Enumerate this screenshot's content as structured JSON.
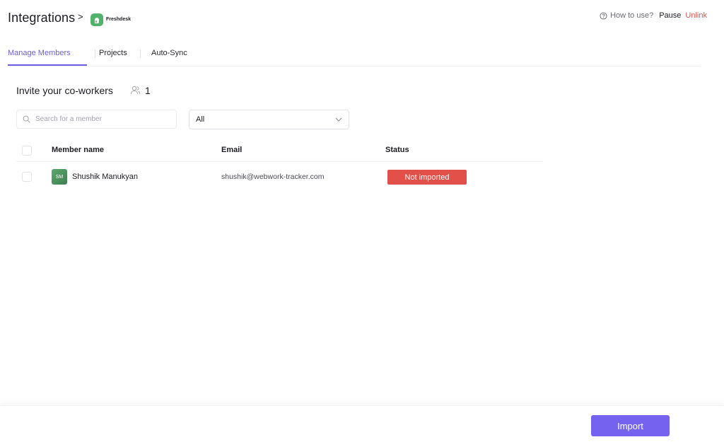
{
  "header": {
    "title": "Integrations",
    "chevron": ">",
    "integration_name": "Freshdesk",
    "help_label": "How to use?",
    "pause_label": "Pause",
    "unlink_label": "Unlink"
  },
  "tabs": [
    {
      "label": "Manage Members",
      "active": true
    },
    {
      "label": "Projects",
      "active": false
    },
    {
      "label": "Auto-Sync",
      "active": false
    }
  ],
  "section": {
    "title": "Invite your co-workers",
    "member_count": "1"
  },
  "search": {
    "placeholder": "Search for a member",
    "value": ""
  },
  "filter": {
    "selected": "All"
  },
  "table": {
    "columns": [
      "Member name",
      "Email",
      "Status"
    ],
    "rows": [
      {
        "initials": "SM",
        "name": "Shushik Manukyan",
        "email": "shushik@webwork-tracker.com",
        "status": "Not imported",
        "checked": false
      }
    ]
  },
  "footer": {
    "import_label": "Import"
  },
  "colors": {
    "accent": "#6c5ce7",
    "button": "#7563f0",
    "danger": "#e2504a",
    "freshdesk_green": "#4fb36b"
  }
}
